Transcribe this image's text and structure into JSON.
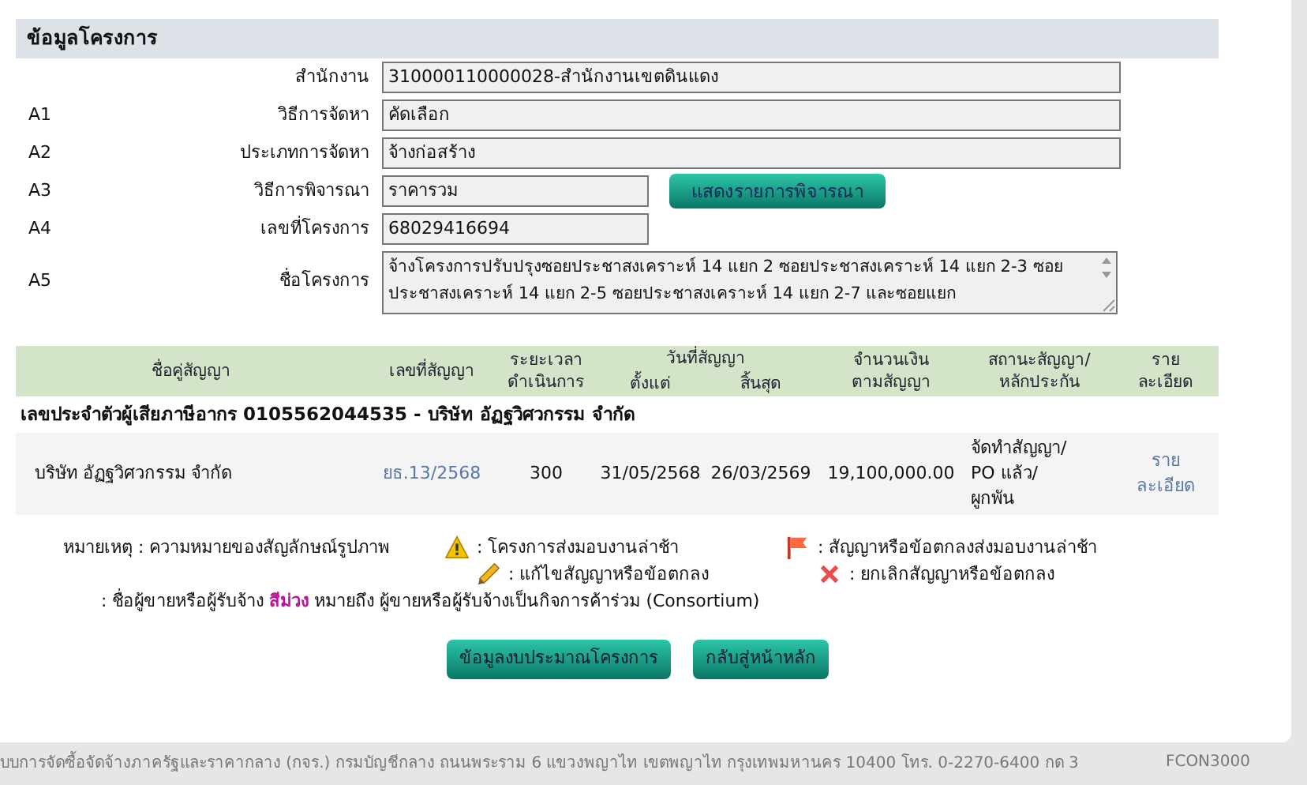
{
  "section_title": "ข้อมูลโครงการ",
  "fields": [
    {
      "label": "สำนักงาน",
      "value": "310000110000028-สำนักงานเขตดินแดง",
      "kind": "wide"
    },
    {
      "code": "A1",
      "label": "วิธีการจัดหา",
      "value": "คัดเลือก",
      "kind": "wide"
    },
    {
      "code": "A2",
      "label": "ประเภทการจัดหา",
      "value": "จ้างก่อสร้าง",
      "kind": "wide"
    },
    {
      "code": "A3",
      "label": "วิธีการพิจารณา",
      "value": "ราคารวม",
      "kind": "short",
      "button": "แสดงรายการพิจารณา"
    },
    {
      "code": "A4",
      "label": "เลขที่โครงการ",
      "value": "68029416694",
      "kind": "short"
    },
    {
      "code": "A5",
      "label": "ชื่อโครงการ",
      "value": "จ้างโครงการปรับปรุงซอยประชาสงเคราะห์ 14 แยก 2 ซอยประชาสงเคราะห์ 14 แยก 2-3 ซอยประชาสงเคราะห์ 14 แยก 2-5 ซอยประชาสงเคราะห์ 14 แยก 2-7 และซอยแยก",
      "kind": "multiline"
    }
  ],
  "table": {
    "date_group": "วันที่สัญญา",
    "columns": [
      "ชื่อคู่สัญญา",
      "เลขที่สัญญา",
      "ระยะเวลา\nดำเนินการ",
      "ตั้งแต่",
      "สิ้นสุด",
      "จำนวนเงิน\nตามสัญญา",
      "สถานะสัญญา/\nหลักประกัน",
      "ราย\nละเอียด"
    ],
    "groups": [
      {
        "title": "เลขประจำตัวผู้เสียภาษีอากร 0105562044535 - บริษัท อัฏฐวิศวกรรม จำกัด",
        "rows": [
          {
            "name": "บริษัท อัฏฐวิศวกรรม จำกัด",
            "contract_no": "ยธ.13/2568",
            "duration": "300",
            "start": "31/05/2568",
            "end": "26/03/2569",
            "amount": "19,100,000.00",
            "status": "จัดทำสัญญา/\nPO แล้ว/\nผูกพัน",
            "detail": "ราย\nละเอียด"
          }
        ]
      }
    ]
  },
  "legend": {
    "note": "หมายเหตุ : ความหมายของสัญลักษณ์รูปภาพ",
    "items": [
      {
        "kind": "warning",
        "text": ": โครงการส่งมอบงานล่าช้า"
      },
      {
        "kind": "flag",
        "text": ": สัญญาหรือข้อตกลงส่งมอบงานล่าช้า"
      },
      {
        "kind": "pencil",
        "text": ": แก้ไขสัญญาหรือข้อตกลง"
      },
      {
        "kind": "cross",
        "text": ": ยกเลิกสัญญาหรือข้อตกลง"
      }
    ],
    "consortium": ": ชื่อผู้ขายหรือผู้รับจ้าง **สีม่วง** หมายถึง ผู้ขายหรือผู้รับจ้างเป็นกิจการค้าร่วม (Consortium)"
  },
  "buttons": [
    "ข้อมูลงบประมาณโครงการ",
    "กลับสู่หน้าหลัก"
  ],
  "footer": {
    "text": "บบการจัดซื้อจัดจ้างภาครัฐและราคากลาง (กจร.) กรมบัญชีกลาง ถนนพระราม 6 แขวงพญาไท เขตพญาไท กรุงเทพมหานคร 10400 โทร. 0-2270-6400 กด 3",
    "code": "FCON3000"
  }
}
